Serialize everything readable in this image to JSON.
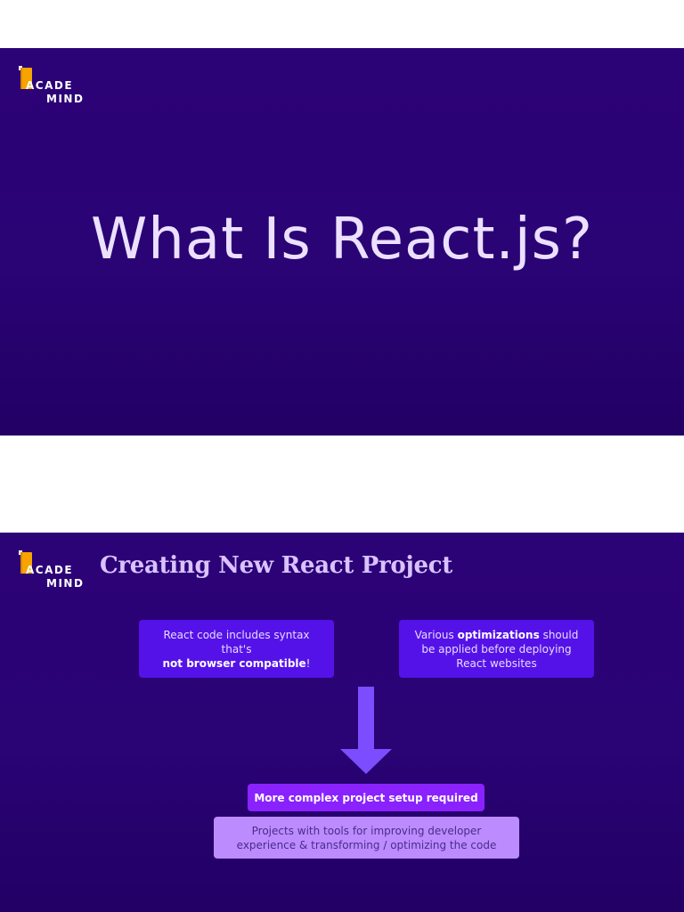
{
  "logo": {
    "line1": "ACADE",
    "line2": "MIND",
    "brand_color": "#f7a400"
  },
  "slide1": {
    "title": "What Is React.js?"
  },
  "slide2": {
    "heading": "Creating New React Project",
    "box_left": {
      "pre": "React code includes syntax that's",
      "bold": "not browser compatible",
      "post": "!"
    },
    "box_right": {
      "pre": "Various ",
      "bold": "optimizations",
      "post": " should be applied before deploying React websites"
    },
    "arrow_icon": "arrow-down-icon",
    "pill_label": "More complex project setup required",
    "description": "Projects with tools for improving developer experience & transforming / optimizing the code"
  },
  "colors": {
    "slide_bg": "#2a0375",
    "box": "#5512e8",
    "pill": "#8a21ff",
    "description_box": "#bc8cff",
    "arrow": "#7b4dff"
  }
}
